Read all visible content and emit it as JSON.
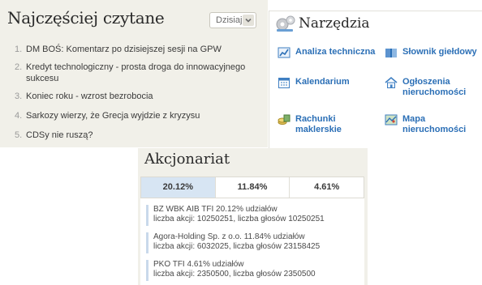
{
  "most_read": {
    "title": "Najczęściej czytane",
    "period_selected": "Dzisiaj",
    "items": [
      {
        "num": "1.",
        "text": "DM BOŚ: Komentarz po dzisiejszej sesji na GPW"
      },
      {
        "num": "2.",
        "text": "Kredyt technologiczny - prosta droga do innowacyjnego sukcesu"
      },
      {
        "num": "3.",
        "text": "Koniec roku - wzrost bezrobocia"
      },
      {
        "num": "4.",
        "text": "Sarkozy wierzy, że Grecja wyjdzie z kryzysu"
      },
      {
        "num": "5.",
        "text": "CDSy nie ruszą?"
      }
    ]
  },
  "tools": {
    "title": "Narzędzia",
    "items": [
      {
        "label": "Analiza techniczna",
        "icon": "chart-icon"
      },
      {
        "label": "Słownik giełdowy",
        "icon": "book-icon"
      },
      {
        "label": "Kalendarium",
        "icon": "calendar-icon"
      },
      {
        "label": "Ogłoszenia nieruchomości",
        "icon": "house-icon"
      },
      {
        "label": "Rachunki maklerskie",
        "icon": "money-icon"
      },
      {
        "label": "Mapa nieruchomości",
        "icon": "map-icon"
      }
    ]
  },
  "shareholders": {
    "title": "Akcjonariat",
    "tabs": [
      "20.12%",
      "11.84%",
      "4.61%"
    ],
    "entries": [
      {
        "line1": "BZ WBK AIB TFI 20.12% udziałów",
        "line2": "liczba akcji: 10250251, liczba głosów 10250251"
      },
      {
        "line1": "Agora-Holding Sp. z o.o. 11.84% udziałów",
        "line2": "liczba akcji: 6032025, liczba głosów 23158425"
      },
      {
        "line1": "PKO TFI 4.61% udziałów",
        "line2": "liczba akcji: 2350500, liczba głosów 2350500"
      }
    ]
  },
  "colors": {
    "panel_bg": "#f1f0e9",
    "link": "#2b6fb6",
    "tab_active": "#d7e5f3"
  }
}
